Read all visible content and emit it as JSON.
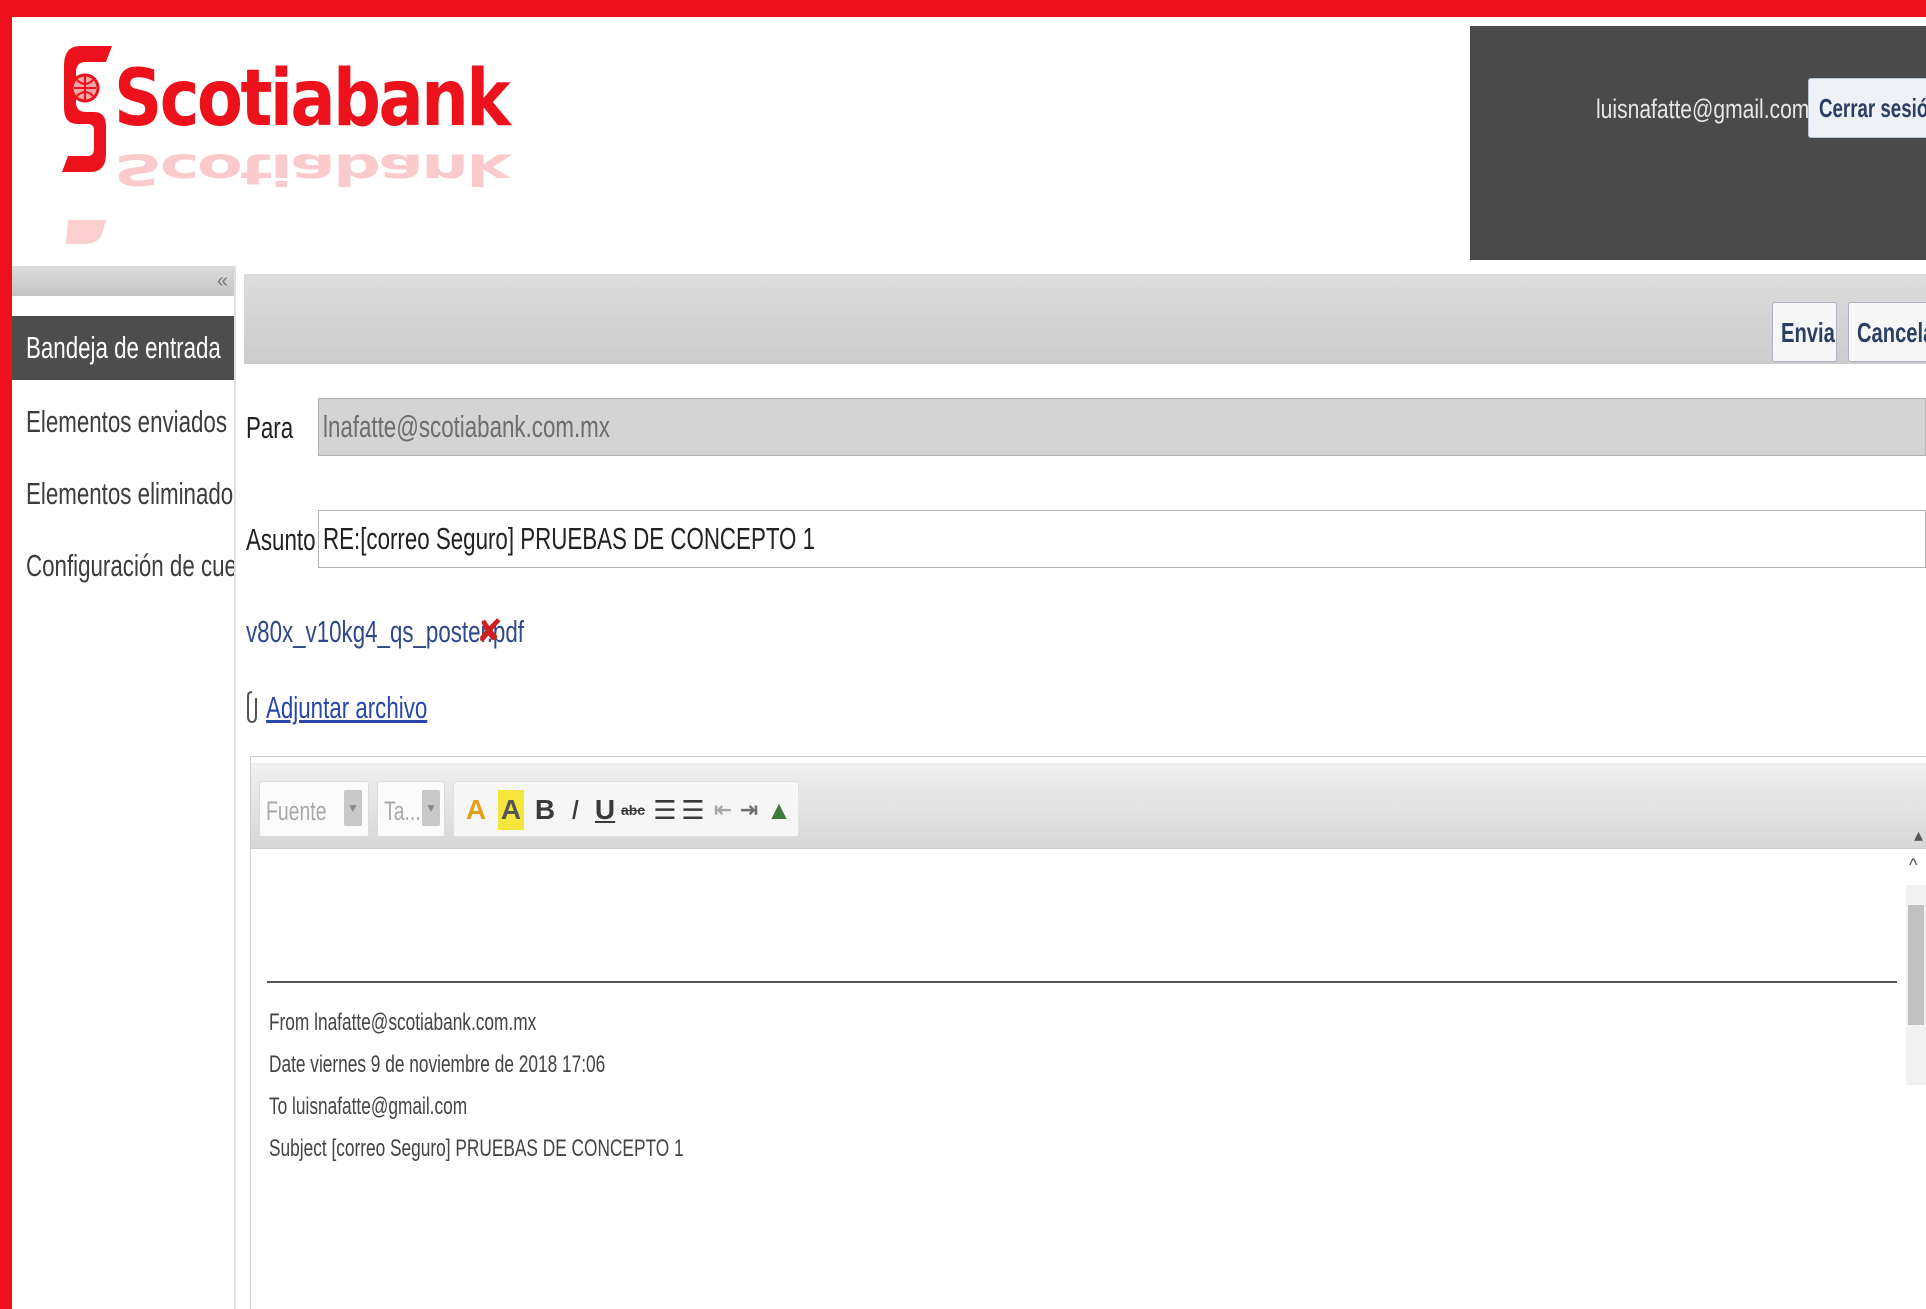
{
  "brand": {
    "name": "Scotiabank",
    "color": "#ec111a"
  },
  "account": {
    "email": "luisnafatte@gmail.com",
    "logout_label": "Cerrar sesión"
  },
  "sidebar": {
    "items": [
      {
        "label": "Bandeja de entrada",
        "active": true
      },
      {
        "label": "Elementos enviados",
        "active": false
      },
      {
        "label": "Elementos eliminados",
        "active": false
      },
      {
        "label": "Configuración de cuenta",
        "active": false
      }
    ]
  },
  "actions": {
    "send_label": "Enviar",
    "cancel_label": "Cancelar"
  },
  "compose": {
    "to_label": "Para",
    "to_value": "lnafatte@scotiabank.com.mx",
    "subject_label": "Asunto",
    "subject_value": "RE:[correo Seguro] PRUEBAS DE CONCEPTO 1",
    "attachment_name": "v80x_v10kg4_qs_poster.pdf",
    "attach_link": "Adjuntar archivo"
  },
  "editor": {
    "font_placeholder": "Fuente",
    "size_placeholder": "Ta...",
    "icons": [
      "font-color-icon",
      "highlight-icon",
      "bold-icon",
      "italic-icon",
      "underline-icon",
      "strikethrough-icon",
      "ordered-list-icon",
      "unordered-list-icon",
      "outdent-icon",
      "indent-icon",
      "image-icon"
    ],
    "quote": {
      "from": "From lnafatte@scotiabank.com.mx",
      "date": "Date viernes 9 de noviembre de 2018 17:06",
      "to": "To luisnafatte@gmail.com",
      "subject": "Subject [correo Seguro] PRUEBAS DE CONCEPTO 1"
    }
  }
}
